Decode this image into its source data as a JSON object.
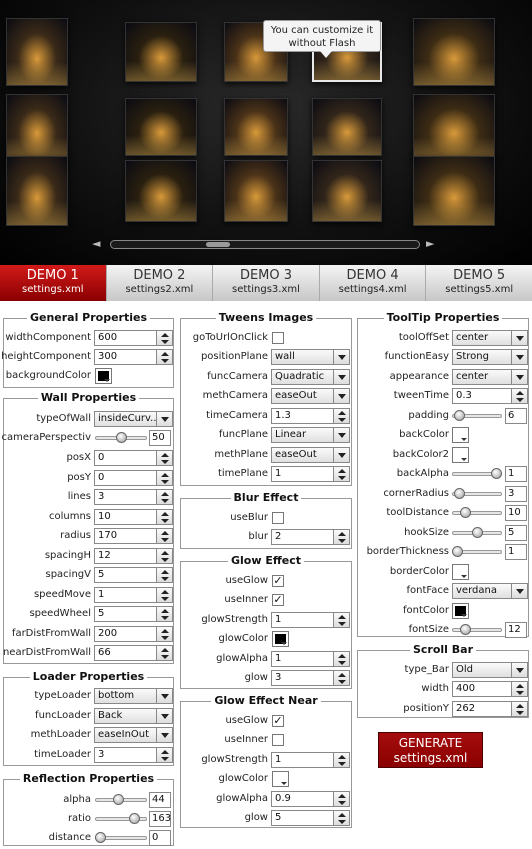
{
  "gallery": {
    "tooltip_line1": "You can customize it",
    "tooltip_line2": "without Flash",
    "scroll_left": "◄",
    "scroll_right": "►"
  },
  "tabs": [
    {
      "label": "DEMO 1",
      "file": "settings.xml",
      "active": true
    },
    {
      "label": "DEMO 2",
      "file": "settings2.xml",
      "active": false
    },
    {
      "label": "DEMO 3",
      "file": "settings3.xml",
      "active": false
    },
    {
      "label": "DEMO 4",
      "file": "settings4.xml",
      "active": false
    },
    {
      "label": "DEMO 5",
      "file": "settings5.xml",
      "active": false
    }
  ],
  "general": {
    "title": "General Properties",
    "widthComponent_label": "widthComponent",
    "widthComponent": "600",
    "heightComponent_label": "heightComponent",
    "heightComponent": "300",
    "backgroundColor_label": "backgroundColor",
    "backgroundColor": "#000000"
  },
  "wall": {
    "title": "Wall Properties",
    "typeOfWall_label": "typeOfWall",
    "typeOfWall": "insideCurv..",
    "cameraPerspective_label": "cameraPerspectiv",
    "cameraPerspective": "50",
    "posX_label": "posX",
    "posX": "0",
    "posY_label": "posY",
    "posY": "0",
    "lines_label": "lines",
    "lines": "3",
    "columns_label": "columns",
    "columns": "10",
    "radius_label": "radius",
    "radius": "170",
    "spacingH_label": "spacingH",
    "spacingH": "12",
    "spacingV_label": "spacingV",
    "spacingV": "5",
    "speedMove_label": "speedMove",
    "speedMove": "1",
    "speedWheel_label": "speedWheel",
    "speedWheel": "5",
    "farDistFromWall_label": "farDistFromWall",
    "farDistFromWall": "200",
    "nearDistFromWall_label": "nearDistFromWall",
    "nearDistFromWall": "66"
  },
  "loader": {
    "title": "Loader Properties",
    "typeLoader_label": "typeLoader",
    "typeLoader": "bottom",
    "funcLoader_label": "funcLoader",
    "funcLoader": "Back",
    "methLoader_label": "methLoader",
    "methLoader": "easeInOut",
    "timeLoader_label": "timeLoader",
    "timeLoader": "3"
  },
  "reflection": {
    "title": "Reflection Properties",
    "alpha_label": "alpha",
    "alpha": "44",
    "ratio_label": "ratio",
    "ratio": "163",
    "distance_label": "distance",
    "distance": "0"
  },
  "tweens": {
    "title": "Tweens Images",
    "goToUrlOnClick_label": "goToUrlOnClick",
    "goToUrlOnClick": false,
    "positionPlane_label": "positionPlane",
    "positionPlane": "wall",
    "funcCamera_label": "funcCamera",
    "funcCamera": "Quadratic",
    "methCamera_label": "methCamera",
    "methCamera": "easeOut",
    "timeCamera_label": "timeCamera",
    "timeCamera": "1.3",
    "funcPlane_label": "funcPlane",
    "funcPlane": "Linear",
    "methPlane_label": "methPlane",
    "methPlane": "easeOut",
    "timePlane_label": "timePlane",
    "timePlane": "1"
  },
  "blur": {
    "title": "Blur Effect",
    "useBlur_label": "useBlur",
    "useBlur": false,
    "blur_label": "blur",
    "blur": "2"
  },
  "glow": {
    "title": "Glow Effect",
    "useGlow_label": "useGlow",
    "useGlow": true,
    "useInner_label": "useInner",
    "useInner": true,
    "glowStrength_label": "glowStrength",
    "glowStrength": "1",
    "glowColor_label": "glowColor",
    "glowColor": "#000000",
    "glowAlpha_label": "glowAlpha",
    "glowAlpha": "1",
    "glow_label": "glow",
    "glow": "3"
  },
  "glowNear": {
    "title": "Glow Effect Near",
    "useGlow_label": "useGlow",
    "useGlow": true,
    "useInner_label": "useInner",
    "useInner": false,
    "glowStrength_label": "glowStrength",
    "glowStrength": "1",
    "glowColor_label": "glowColor",
    "glowColor": "#ffffff",
    "glowAlpha_label": "glowAlpha",
    "glowAlpha": "0.9",
    "glow_label": "glow",
    "glow": "5"
  },
  "tooltipProps": {
    "title": "ToolTip Properties",
    "toolOffSet_label": "toolOffSet",
    "toolOffSet": "center",
    "functionEasy_label": "functionEasy",
    "functionEasy": "Strong",
    "appearance_label": "appearance",
    "appearance": "center",
    "tweenTime_label": "tweenTime",
    "tweenTime": "0.3",
    "padding_label": "padding",
    "padding": "6",
    "backColor_label": "backColor",
    "backColor": "#ffffff",
    "backColor2_label": "backColor2",
    "backColor2": "#ffffff",
    "backAlpha_label": "backAlpha",
    "backAlpha": "1",
    "cornerRadius_label": "cornerRadius",
    "cornerRadius": "3",
    "toolDistance_label": "toolDistance",
    "toolDistance": "10",
    "hookSize_label": "hookSize",
    "hookSize": "5",
    "borderThickness_label": "borderThickness",
    "borderThickness": "1",
    "borderColor_label": "borderColor",
    "borderColor": "#ffffff",
    "fontFace_label": "fontFace",
    "fontFace": "verdana",
    "fontColor_label": "fontColor",
    "fontColor": "#000000",
    "fontSize_label": "fontSize",
    "fontSize": "12"
  },
  "scrollBar": {
    "title": "Scroll Bar",
    "type_Bar_label": "type_Bar",
    "type_Bar": "Old",
    "width_label": "width",
    "width": "400",
    "positionY_label": "positionY",
    "positionY": "262"
  },
  "generate": {
    "line1": "GENERATE",
    "line2": "settings.xml",
    "color": "#8a0000"
  },
  "slider_levels": {
    "cameraPerspective": 0.5,
    "alpha": 0.44,
    "ratio": 0.82,
    "distance": 0.0,
    "padding": 0.06,
    "backAlpha": 1.0,
    "cornerRadius": 0.06,
    "toolDistance": 0.2,
    "hookSize": 0.5,
    "borderThickness": 0.0,
    "fontSize": 0.2
  }
}
